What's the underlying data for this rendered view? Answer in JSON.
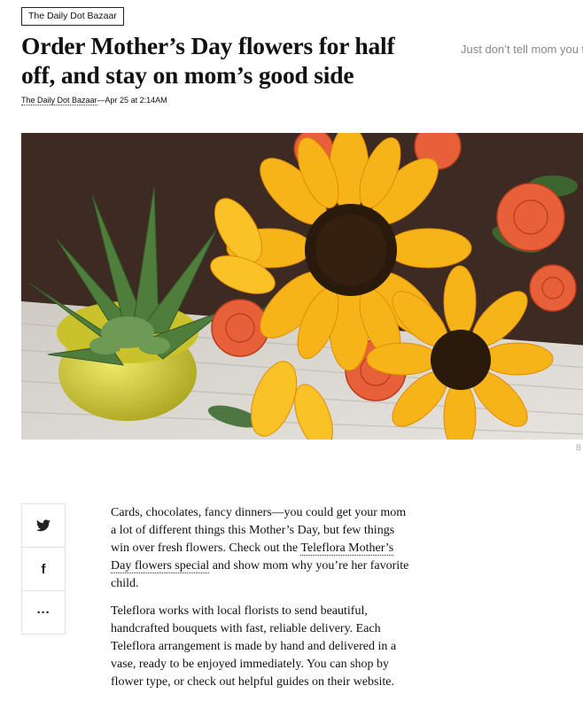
{
  "section_tag": "The Daily Dot Bazaar",
  "headline": "Order Mother’s Day flowers for half off, and stay on mom’s good side",
  "dek": "Just don’t tell mom you to discount.",
  "byline": {
    "author": "The Daily Dot Bazaar",
    "separator": "—",
    "timestamp": "Apr 25 at 2:14AM"
  },
  "hero": {
    "subject": "sunflowers, roses and a succulent in a yellow pot",
    "credit": "B"
  },
  "share": [
    {
      "icon": "twitter-icon",
      "glyph": "t"
    },
    {
      "icon": "facebook-icon",
      "glyph": "f"
    },
    {
      "icon": "more-icon",
      "glyph": "···"
    }
  ],
  "article": {
    "p1_before": "Cards, chocolates, fancy dinners—you could get your mom a lot of different things this Mother’s Day, but few things win over fresh flowers. Check out the ",
    "p1_link": "Teleflora Mother’s Day flowers special",
    "p1_after": " and show mom why you’re her favorite child.",
    "p2": "Teleflora works with local florists to send beautiful, handcrafted bouquets with fast, reliable delivery. Each Teleflora arrangement is made by hand and delivered in a vase, ready to be enjoyed immediately. You can shop by flower type, or check out helpful guides on their website."
  },
  "colors": {
    "background": "#ffffff",
    "text": "#111111",
    "dek": "#888888",
    "sunflower_petal": "#f7b418",
    "sunflower_center": "#2a1a0c",
    "rose": "#e8603a",
    "pot": "#d9d235",
    "table": "#d8d5cf"
  }
}
